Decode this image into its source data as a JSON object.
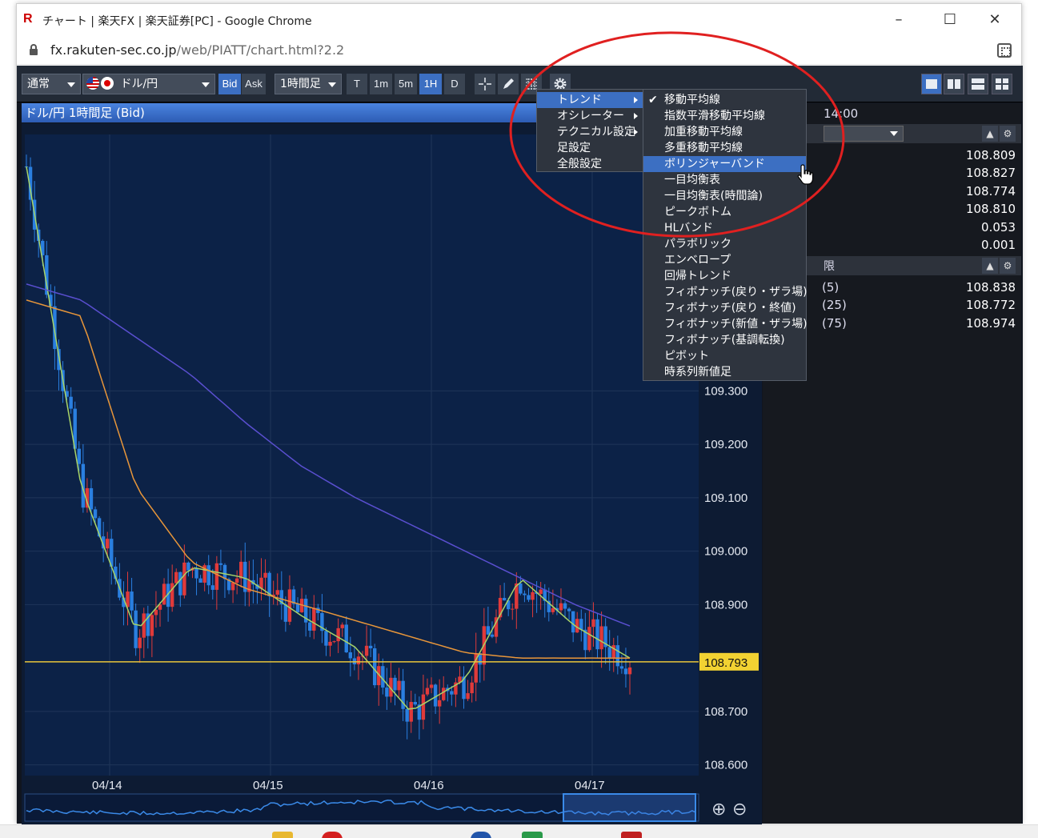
{
  "window": {
    "logo": "R",
    "title": "チャート | 楽天FX | 楽天証券[PC] - Google Chrome",
    "minimize": "–",
    "maximize": "☐",
    "close": "✕"
  },
  "address": {
    "host": "fx.rakuten-sec.co.jp",
    "path": "/web/PIATT/chart.html?2.2"
  },
  "toolbar": {
    "mode": "通常",
    "pair": "ドル/円",
    "bid": "Bid",
    "ask": "Ask",
    "interval": "1時間足",
    "tf": [
      "T",
      "1m",
      "5m",
      "1H",
      "D"
    ],
    "active_tf": "1H"
  },
  "chart": {
    "header": "ドル/円 1時間足 (Bid)",
    "current_price": "108.793",
    "y_ticks": [
      "109.300",
      "109.200",
      "109.100",
      "109.000",
      "108.900",
      "108.700",
      "108.600"
    ],
    "x_ticks": [
      "04/14",
      "04/15",
      "04/16",
      "04/17"
    ],
    "zoom_in": "⊕",
    "zoom_out": "⊖"
  },
  "chart_data": {
    "type": "line",
    "title": "ドル/円 1時間足 (Bid)",
    "xlabel": "",
    "ylabel": "",
    "ylim": [
      108.58,
      109.78
    ],
    "x": [
      "04/14",
      "04/15",
      "04/16",
      "04/17"
    ],
    "series": [
      {
        "values": [
          109.72,
          109.12,
          108.85,
          108.97,
          108.95,
          108.88,
          108.82,
          108.7,
          108.76,
          108.95,
          108.86,
          108.8
        ]
      },
      {
        "values": [
          109.47,
          109.44,
          109.12,
          108.98,
          108.93,
          108.9,
          108.87,
          108.84,
          108.81,
          108.8,
          108.8,
          108.8
        ]
      },
      {
        "values": [
          109.5,
          109.47,
          109.4,
          109.33,
          109.24,
          109.16,
          109.1,
          109.05,
          109.0,
          108.95,
          108.9,
          108.86
        ]
      }
    ],
    "current_price_line": 108.793
  },
  "right_panel": {
    "time": "14:00",
    "values1": [
      "108.809",
      "108.827",
      "108.774",
      "108.810",
      "0.053",
      "0.001"
    ],
    "section2": "限",
    "rows2": [
      {
        "label": "(5)",
        "value": "108.838"
      },
      {
        "label": "(25)",
        "value": "108.772"
      },
      {
        "label": "(75)",
        "value": "108.974"
      }
    ]
  },
  "menu": {
    "main": [
      {
        "label": "トレンド",
        "submenu": true
      },
      {
        "label": "オシレーター",
        "submenu": true
      },
      {
        "label": "テクニカル設定",
        "submenu": true
      },
      {
        "label": "足設定",
        "submenu": false
      },
      {
        "label": "全般設定",
        "submenu": false
      }
    ],
    "trend": [
      "移動平均線",
      "指数平滑移動平均線",
      "加重移動平均線",
      "多重移動平均線",
      "ボリンジャーバンド",
      "一目均衡表",
      "一目均衡表(時間論)",
      "ピークボトム",
      "HLバンド",
      "パラボリック",
      "エンベロープ",
      "回帰トレンド",
      "フィボナッチ(戻り・ザラ場)",
      "フィボナッチ(戻り・終値)",
      "フィボナッチ(新値・ザラ場)",
      "フィボナッチ(基調転換)",
      "ピボット",
      "時系列新値足"
    ],
    "checked": "移動平均線",
    "highlighted": "ボリンジャーバンド"
  },
  "colors": {
    "accent": "#3c6fc2",
    "chart_bg": "#0d1b33",
    "up_candle": "#e03a3a",
    "down_candle": "#2a7fe0",
    "ma_short": "#a8d468",
    "ma_mid": "#e8963a",
    "ma_long": "#5a4fd0",
    "price_line": "#e8c53a",
    "annotation": "#e02020"
  }
}
